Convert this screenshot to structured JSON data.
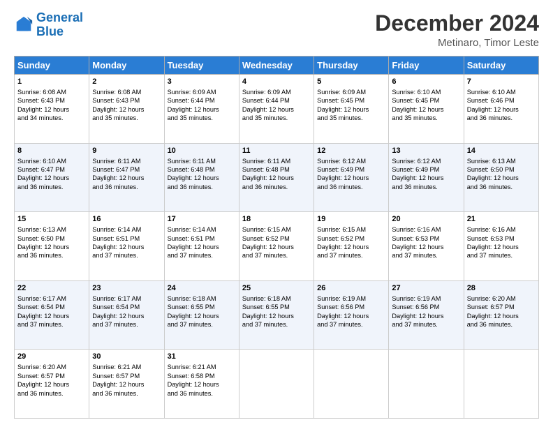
{
  "logo": {
    "line1": "General",
    "line2": "Blue"
  },
  "title": "December 2024",
  "location": "Metinaro, Timor Leste",
  "days_of_week": [
    "Sunday",
    "Monday",
    "Tuesday",
    "Wednesday",
    "Thursday",
    "Friday",
    "Saturday"
  ],
  "weeks": [
    [
      {
        "day": "1",
        "sunrise": "6:08 AM",
        "sunset": "6:43 PM",
        "daylight": "12 hours and 34 minutes."
      },
      {
        "day": "2",
        "sunrise": "6:08 AM",
        "sunset": "6:43 PM",
        "daylight": "12 hours and 35 minutes."
      },
      {
        "day": "3",
        "sunrise": "6:09 AM",
        "sunset": "6:44 PM",
        "daylight": "12 hours and 35 minutes."
      },
      {
        "day": "4",
        "sunrise": "6:09 AM",
        "sunset": "6:44 PM",
        "daylight": "12 hours and 35 minutes."
      },
      {
        "day": "5",
        "sunrise": "6:09 AM",
        "sunset": "6:45 PM",
        "daylight": "12 hours and 35 minutes."
      },
      {
        "day": "6",
        "sunrise": "6:10 AM",
        "sunset": "6:45 PM",
        "daylight": "12 hours and 35 minutes."
      },
      {
        "day": "7",
        "sunrise": "6:10 AM",
        "sunset": "6:46 PM",
        "daylight": "12 hours and 36 minutes."
      }
    ],
    [
      {
        "day": "8",
        "sunrise": "6:10 AM",
        "sunset": "6:47 PM",
        "daylight": "12 hours and 36 minutes."
      },
      {
        "day": "9",
        "sunrise": "6:11 AM",
        "sunset": "6:47 PM",
        "daylight": "12 hours and 36 minutes."
      },
      {
        "day": "10",
        "sunrise": "6:11 AM",
        "sunset": "6:48 PM",
        "daylight": "12 hours and 36 minutes."
      },
      {
        "day": "11",
        "sunrise": "6:11 AM",
        "sunset": "6:48 PM",
        "daylight": "12 hours and 36 minutes."
      },
      {
        "day": "12",
        "sunrise": "6:12 AM",
        "sunset": "6:49 PM",
        "daylight": "12 hours and 36 minutes."
      },
      {
        "day": "13",
        "sunrise": "6:12 AM",
        "sunset": "6:49 PM",
        "daylight": "12 hours and 36 minutes."
      },
      {
        "day": "14",
        "sunrise": "6:13 AM",
        "sunset": "6:50 PM",
        "daylight": "12 hours and 36 minutes."
      }
    ],
    [
      {
        "day": "15",
        "sunrise": "6:13 AM",
        "sunset": "6:50 PM",
        "daylight": "12 hours and 36 minutes."
      },
      {
        "day": "16",
        "sunrise": "6:14 AM",
        "sunset": "6:51 PM",
        "daylight": "12 hours and 37 minutes."
      },
      {
        "day": "17",
        "sunrise": "6:14 AM",
        "sunset": "6:51 PM",
        "daylight": "12 hours and 37 minutes."
      },
      {
        "day": "18",
        "sunrise": "6:15 AM",
        "sunset": "6:52 PM",
        "daylight": "12 hours and 37 minutes."
      },
      {
        "day": "19",
        "sunrise": "6:15 AM",
        "sunset": "6:52 PM",
        "daylight": "12 hours and 37 minutes."
      },
      {
        "day": "20",
        "sunrise": "6:16 AM",
        "sunset": "6:53 PM",
        "daylight": "12 hours and 37 minutes."
      },
      {
        "day": "21",
        "sunrise": "6:16 AM",
        "sunset": "6:53 PM",
        "daylight": "12 hours and 37 minutes."
      }
    ],
    [
      {
        "day": "22",
        "sunrise": "6:17 AM",
        "sunset": "6:54 PM",
        "daylight": "12 hours and 37 minutes."
      },
      {
        "day": "23",
        "sunrise": "6:17 AM",
        "sunset": "6:54 PM",
        "daylight": "12 hours and 37 minutes."
      },
      {
        "day": "24",
        "sunrise": "6:18 AM",
        "sunset": "6:55 PM",
        "daylight": "12 hours and 37 minutes."
      },
      {
        "day": "25",
        "sunrise": "6:18 AM",
        "sunset": "6:55 PM",
        "daylight": "12 hours and 37 minutes."
      },
      {
        "day": "26",
        "sunrise": "6:19 AM",
        "sunset": "6:56 PM",
        "daylight": "12 hours and 37 minutes."
      },
      {
        "day": "27",
        "sunrise": "6:19 AM",
        "sunset": "6:56 PM",
        "daylight": "12 hours and 37 minutes."
      },
      {
        "day": "28",
        "sunrise": "6:20 AM",
        "sunset": "6:57 PM",
        "daylight": "12 hours and 36 minutes."
      }
    ],
    [
      {
        "day": "29",
        "sunrise": "6:20 AM",
        "sunset": "6:57 PM",
        "daylight": "12 hours and 36 minutes."
      },
      {
        "day": "30",
        "sunrise": "6:21 AM",
        "sunset": "6:57 PM",
        "daylight": "12 hours and 36 minutes."
      },
      {
        "day": "31",
        "sunrise": "6:21 AM",
        "sunset": "6:58 PM",
        "daylight": "12 hours and 36 minutes."
      },
      null,
      null,
      null,
      null
    ]
  ]
}
